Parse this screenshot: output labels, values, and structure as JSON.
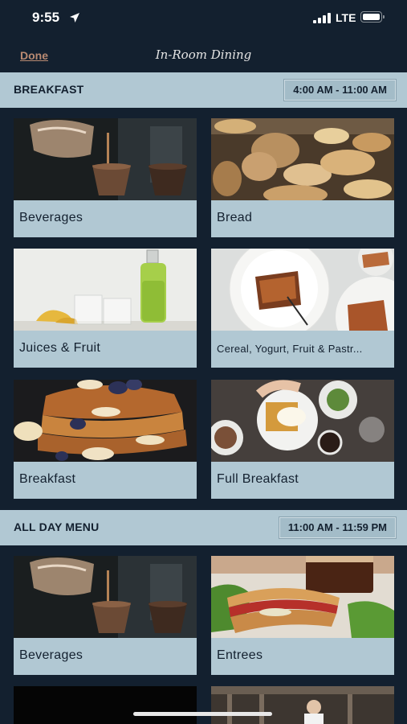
{
  "status_bar": {
    "time": "9:55",
    "network": "LTE"
  },
  "nav": {
    "done_label": "Done",
    "title": "In-Room Dining"
  },
  "sections": [
    {
      "title": "BREAKFAST",
      "hours": "4:00 AM - 11:00 AM",
      "items": [
        {
          "label": "Beverages"
        },
        {
          "label": "Bread"
        },
        {
          "label": "Juices & Fruit"
        },
        {
          "label": "Cereal, Yogurt, Fruit & Pastr..."
        },
        {
          "label": "Breakfast"
        },
        {
          "label": "Full Breakfast"
        }
      ]
    },
    {
      "title": "ALL DAY MENU",
      "hours": "11:00 AM - 11:59 PM",
      "items": [
        {
          "label": "Beverages"
        },
        {
          "label": "Entrees"
        }
      ]
    }
  ],
  "colors": {
    "background": "#13202f",
    "accent": "#b1c8d3",
    "done": "#b98a72"
  }
}
